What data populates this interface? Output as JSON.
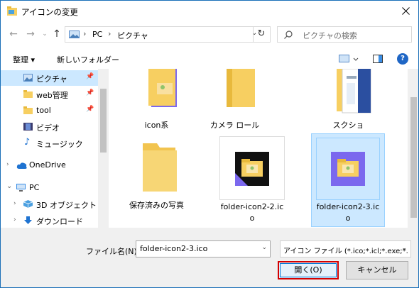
{
  "window": {
    "title": "アイコンの変更"
  },
  "nav": {
    "address": [
      "PC",
      "ピクチャ"
    ],
    "search_placeholder": "ピクチャの検索"
  },
  "toolbar": {
    "organize": "整理 ▾",
    "new_folder": "新しいフォルダー"
  },
  "sidebar": {
    "items": [
      {
        "label": "ピクチャ",
        "pinned": true,
        "selected": true
      },
      {
        "label": "web管理",
        "pinned": true
      },
      {
        "label": "tool",
        "pinned": true
      },
      {
        "label": "ビデオ"
      },
      {
        "label": "ミュージック"
      },
      {
        "label": "OneDrive"
      },
      {
        "label": "PC"
      },
      {
        "label": "3D オブジェクト"
      },
      {
        "label": "ダウンロード"
      }
    ]
  },
  "files": [
    {
      "name": "icon系"
    },
    {
      "name": "カメラ ロール"
    },
    {
      "name": "スクショ"
    },
    {
      "name": "保存済みの写真"
    },
    {
      "name_line1": "folder-icon2-2.ic",
      "name_line2": "o"
    },
    {
      "name_line1": "folder-icon2-3.ic",
      "name_line2": "o",
      "selected": true
    }
  ],
  "bottom": {
    "filename_label": "ファイル名(N):",
    "filename_value": "folder-icon2-3.ico",
    "filetype_value": "アイコン ファイル (*.ico;*.icl;*.exe;*.",
    "open_label": "開く(O)",
    "cancel_label": "キャンセル"
  },
  "colors": {
    "accent": "#0078d7",
    "highlight": "#d40000",
    "selection": "#cce8ff",
    "folder": "#f7cf61",
    "purple": "#7b68ee"
  }
}
